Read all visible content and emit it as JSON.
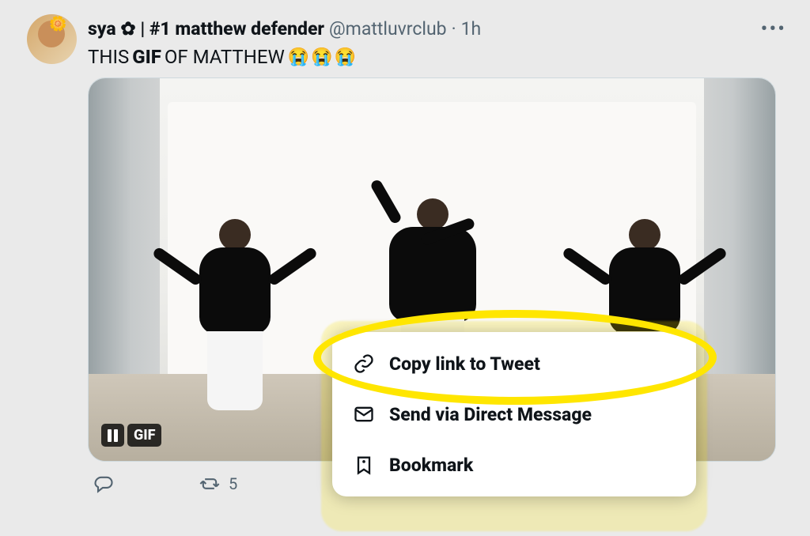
{
  "user": {
    "display_name": "sya ✿ | #1 matthew defender",
    "handle": "@mattluvrclub",
    "separator": "·",
    "time": "1h"
  },
  "tweet": {
    "text_pre": "THIS ",
    "text_bold": "GIF",
    "text_post": " OF MATTHEW ",
    "emojis": "😭😭😭"
  },
  "media": {
    "pause_label": "II",
    "gif_label": "GIF"
  },
  "actions": {
    "reply_count": "",
    "retweet_count": "5"
  },
  "share_menu": {
    "copy_link": "Copy link to Tweet",
    "send_dm": "Send via Direct Message",
    "bookmark": "Bookmark"
  }
}
